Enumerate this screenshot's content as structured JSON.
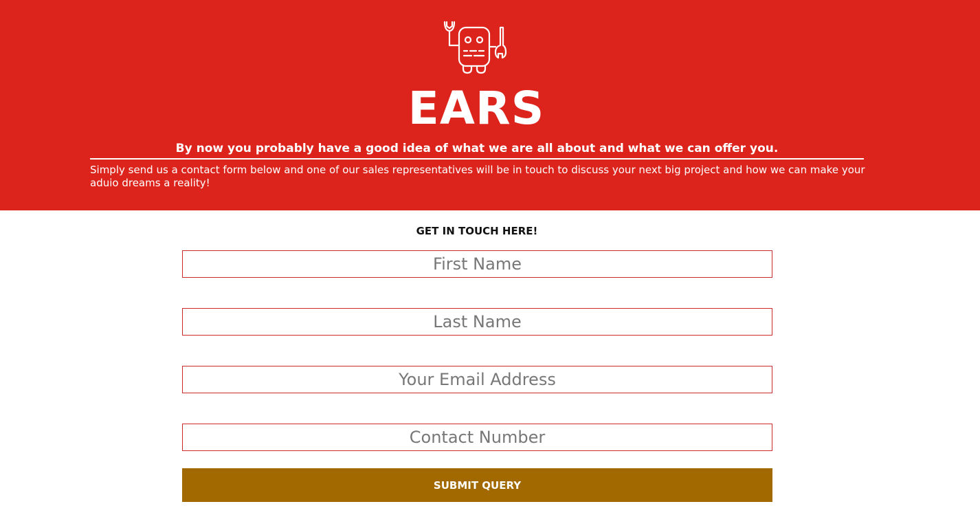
{
  "header": {
    "logo_icon": "robot-with-wrenches-icon",
    "brand": "EARS",
    "tagline": "By now you probably have a good idea of what we are all about and what we can offer you.",
    "intro": "Simply send us a contact form below and one of our sales representatives will be in touch to discuss your next big project and how we can make your aduio dreams a reality!"
  },
  "form": {
    "heading": "GET IN TOUCH HERE!",
    "first_name": {
      "placeholder": "First Name",
      "value": ""
    },
    "last_name": {
      "placeholder": "Last Name",
      "value": ""
    },
    "email": {
      "placeholder": "Your Email Address",
      "value": ""
    },
    "phone": {
      "placeholder": "Contact Number",
      "value": ""
    },
    "submit_label": "SUBMIT QUERY"
  },
  "colors": {
    "hero_background": "#dc241c",
    "submit_background": "#a16900",
    "field_border": "#cc2a2a"
  }
}
